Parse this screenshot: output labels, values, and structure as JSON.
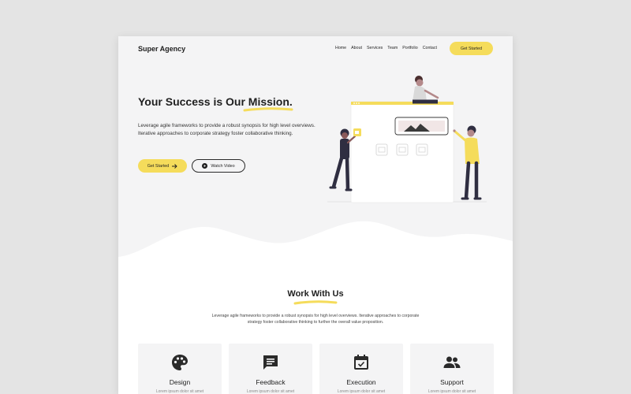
{
  "navbar": {
    "brand": "Super Agency",
    "links": [
      "Home",
      "About",
      "Services",
      "Team",
      "Portfolio",
      "Contact"
    ],
    "cta": "Get Started"
  },
  "hero": {
    "title": "Your Success is Our Mission.",
    "text": "Leverage agile frameworks to provide a robust synopsis for high level overviews. Iterative approaches to corporate strategy foster collaborative thinking.",
    "primary_button": "Get Started",
    "secondary_button": "Watch Video"
  },
  "work": {
    "title": "Work With Us",
    "text": "Leverage agile frameworks to provide a robust synopsis for high level overviews. Iterative approaches to corporate strategy foster collaborative thinking to further the overall value proposition.",
    "cards": [
      {
        "label": "Design",
        "icon": "palette-icon",
        "sub": "Lorem ipsum dolor sit amet"
      },
      {
        "label": "Feedback",
        "icon": "feedback-icon",
        "sub": "Lorem ipsum dolor sit amet"
      },
      {
        "label": "Execution",
        "icon": "calendar-check-icon",
        "sub": "Lorem ipsum dolor sit amet"
      },
      {
        "label": "Support",
        "icon": "people-icon",
        "sub": "Lorem ipsum dolor sit amet"
      }
    ]
  },
  "colors": {
    "accent": "#f5dc5b",
    "dark": "#1f1f1f",
    "background": "#f4f4f5",
    "outer": "#e4e4e4"
  }
}
